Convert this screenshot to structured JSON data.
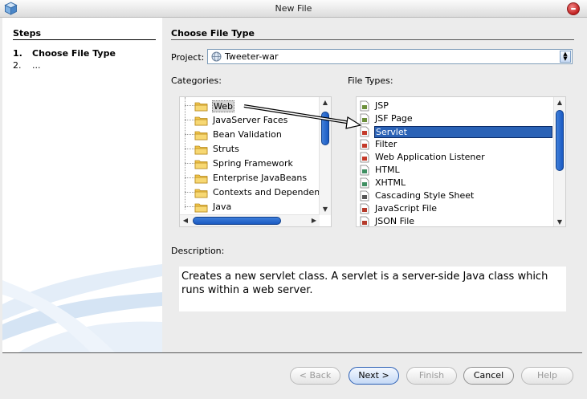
{
  "window": {
    "title": "New File"
  },
  "steps": {
    "title": "Steps",
    "items": [
      {
        "num": "1.",
        "label": "Choose File Type"
      },
      {
        "num": "2.",
        "label": "..."
      }
    ]
  },
  "main": {
    "title": "Choose File Type",
    "project_label": "Project:",
    "project_value": "Tweeter-war",
    "categories_label": "Categories:",
    "file_types_label": "File Types:",
    "categories": [
      {
        "label": "Web",
        "icon": "folder-icon"
      },
      {
        "label": "JavaServer Faces",
        "icon": "folder-icon"
      },
      {
        "label": "Bean Validation",
        "icon": "folder-icon"
      },
      {
        "label": "Struts",
        "icon": "folder-icon"
      },
      {
        "label": "Spring Framework",
        "icon": "folder-icon"
      },
      {
        "label": "Enterprise JavaBeans",
        "icon": "folder-icon"
      },
      {
        "label": "Contexts and Dependency",
        "icon": "folder-icon"
      },
      {
        "label": "Java",
        "icon": "folder-icon"
      }
    ],
    "selected_category": "Web",
    "file_types": [
      {
        "label": "JSP",
        "icon": "jsp-file-icon"
      },
      {
        "label": "JSF Page",
        "icon": "jsf-file-icon"
      },
      {
        "label": "Servlet",
        "icon": "servlet-file-icon"
      },
      {
        "label": "Filter",
        "icon": "filter-file-icon"
      },
      {
        "label": "Web Application Listener",
        "icon": "listener-file-icon"
      },
      {
        "label": "HTML",
        "icon": "html-file-icon"
      },
      {
        "label": "XHTML",
        "icon": "xhtml-file-icon"
      },
      {
        "label": "Cascading Style Sheet",
        "icon": "css-file-icon"
      },
      {
        "label": "JavaScript File",
        "icon": "javascript-file-icon"
      },
      {
        "label": "JSON File",
        "icon": "json-file-icon"
      }
    ],
    "selected_file_type": "Servlet",
    "description_label": "Description:",
    "description": "Creates a new servlet class. A servlet is a server-side Java class which runs within a web server."
  },
  "buttons": {
    "back": "< Back",
    "next": "Next >",
    "finish": "Finish",
    "cancel": "Cancel",
    "help": "Help"
  },
  "colors": {
    "selection": "#2a62b6",
    "scroll_thumb": "#2a6ad0",
    "pane_background": "#ececec",
    "close_button": "#c01f1f"
  }
}
